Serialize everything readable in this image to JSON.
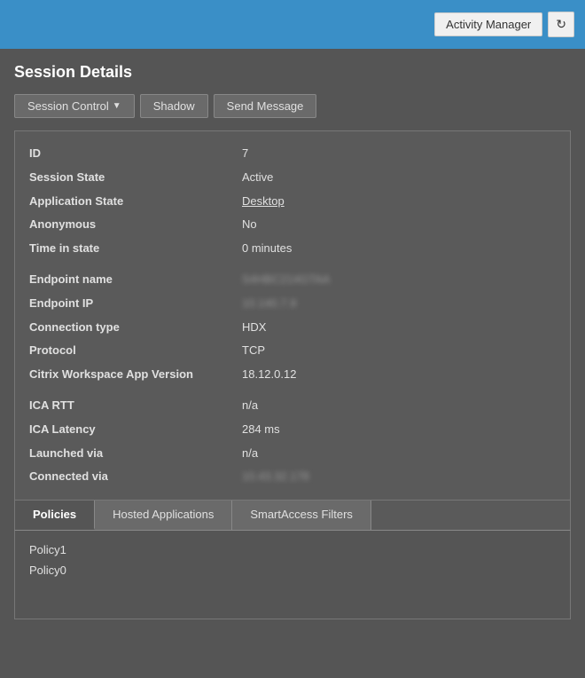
{
  "topbar": {
    "activity_manager_label": "Activity Manager",
    "refresh_icon": "↻"
  },
  "page": {
    "title": "Session Details"
  },
  "toolbar": {
    "session_control_label": "Session Control",
    "shadow_label": "Shadow",
    "send_message_label": "Send Message"
  },
  "details": {
    "fields": [
      {
        "label": "ID",
        "value": "7",
        "blurred": false,
        "link": false
      },
      {
        "label": "Session State",
        "value": "Active",
        "blurred": false,
        "link": false
      },
      {
        "label": "Application State",
        "value": "Desktop",
        "blurred": false,
        "link": true
      },
      {
        "label": "Anonymous",
        "value": "No",
        "blurred": false,
        "link": false
      },
      {
        "label": "Time in state",
        "value": "0 minutes",
        "blurred": false,
        "link": false
      },
      {
        "spacer": true
      },
      {
        "label": "Endpoint name",
        "value": "S4HBC214GTAA",
        "blurred": true,
        "link": false
      },
      {
        "label": "Endpoint IP",
        "value": "10.140.7.9",
        "blurred": true,
        "link": false
      },
      {
        "label": "Connection type",
        "value": "HDX",
        "blurred": false,
        "link": false
      },
      {
        "label": "Protocol",
        "value": "TCP",
        "blurred": false,
        "link": false
      },
      {
        "label": "Citrix Workspace App Version",
        "value": "18.12.0.12",
        "blurred": false,
        "link": false
      },
      {
        "spacer": true
      },
      {
        "label": "ICA RTT",
        "value": "n/a",
        "blurred": false,
        "link": false
      },
      {
        "label": "ICA Latency",
        "value": "284 ms",
        "blurred": false,
        "link": false
      },
      {
        "label": "Launched via",
        "value": "n/a",
        "blurred": false,
        "link": false
      },
      {
        "label": "Connected via",
        "value": "10.43.32.178",
        "blurred": true,
        "link": false
      }
    ]
  },
  "tabs": {
    "items": [
      {
        "id": "policies",
        "label": "Policies",
        "active": true
      },
      {
        "id": "hosted-applications",
        "label": "Hosted Applications",
        "active": false
      },
      {
        "id": "smartaccess-filters",
        "label": "SmartAccess Filters",
        "active": false
      }
    ],
    "policies_content": [
      {
        "name": "Policy1"
      },
      {
        "name": "Policy0"
      }
    ]
  }
}
